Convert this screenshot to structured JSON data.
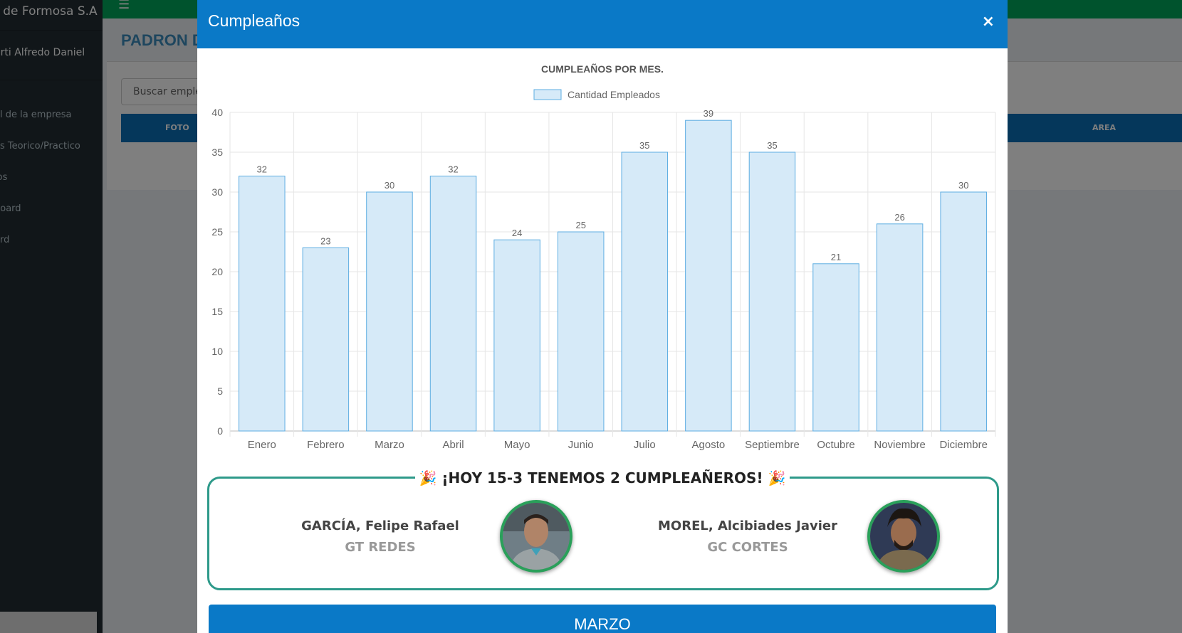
{
  "sidebar": {
    "brand": "s de Formosa S.A",
    "user": "erti Alfredo Daniel",
    "items": [
      {
        "label": "al de la empresa"
      },
      {
        "label": "os Teorico/Practico"
      },
      {
        "label": "ios"
      },
      {
        "label": "board"
      },
      {
        "label": "ard"
      }
    ]
  },
  "topbar": {
    "menu_icon": "hamburger-icon"
  },
  "page": {
    "title": "PADRON D",
    "search_placeholder": "Buscar emple",
    "table_headers": {
      "foto": "FOTO",
      "area": "AREA"
    }
  },
  "modal": {
    "title": "Cumpleaños",
    "close_label": "×"
  },
  "chart_data": {
    "type": "bar",
    "title": "CUMPLEAÑOS POR MES.",
    "categories": [
      "Enero",
      "Febrero",
      "Marzo",
      "Abril",
      "Mayo",
      "Junio",
      "Julio",
      "Agosto",
      "Septiembre",
      "Octubre",
      "Noviembre",
      "Diciembre"
    ],
    "series": [
      {
        "name": "Cantidad Empleados",
        "values": [
          32,
          23,
          30,
          32,
          24,
          25,
          35,
          39,
          35,
          21,
          26,
          30
        ]
      }
    ],
    "ylim": [
      0,
      40
    ],
    "yticks": [
      0,
      5,
      10,
      15,
      20,
      25,
      30,
      35,
      40
    ],
    "grid": true,
    "legend": "top",
    "colors": {
      "fill": "#d6eaf8",
      "stroke": "#5dade2"
    }
  },
  "birthdays": {
    "heading": "¡HOY 15-3 TENEMOS 2 CUMPLEAÑEROS!",
    "people": [
      {
        "name": "GARCÍA, Felipe Rafael",
        "area": "GT REDES"
      },
      {
        "name": "MOREL, Alcibiades Javier",
        "area": "GC CORTES"
      }
    ]
  },
  "month_section": {
    "label": "MARZO"
  },
  "colors": {
    "header": "#0a79c7",
    "sidebar": "#222d32",
    "topbar": "#00a65a",
    "frame": "#2e9a8a",
    "avatar_border": "#2aa05a"
  }
}
